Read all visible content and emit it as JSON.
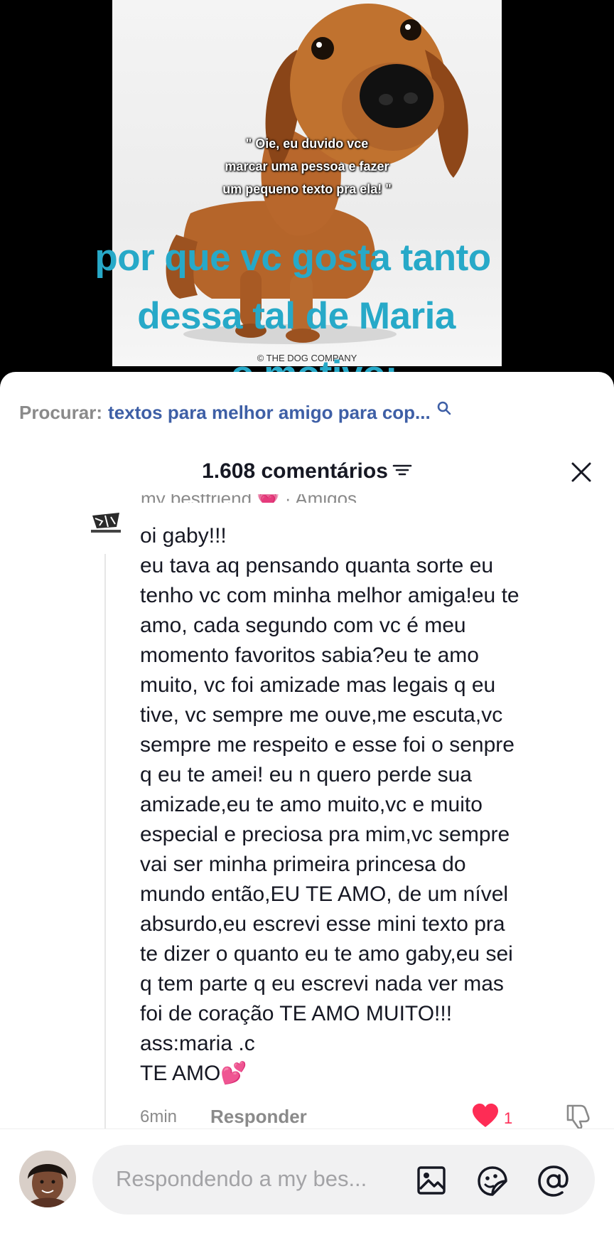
{
  "video": {
    "quote_lines": [
      "\" Oie, eu duvido vce",
      "marcar uma pessoa e fazer",
      "um pequeno texto pra ela! \""
    ],
    "watermark": "© THE DOG COMPANY",
    "caption_lines": [
      "por que vc gosta tanto",
      "dessa tal de Maria",
      "o motivo:"
    ]
  },
  "search": {
    "label": "Procurar:",
    "query": "textos para melhor amigo para cop...",
    "icon": "search-icon"
  },
  "header": {
    "count": "1.608 comentários",
    "filter_icon": "filter-icon",
    "close_icon": "close-icon"
  },
  "comment": {
    "author": "my bestfriend 💗 · Amigos",
    "text": "oi gaby!!!\neu tava aq pensando quanta sorte eu\ntenho vc com minha melhor amiga!eu te\namo, cada segundo com vc é meu\nmomento favoritos sabia?eu te amo\nmuito, vc foi amizade mas legais q eu\ntive, vc sempre me ouve,me escuta,vc\nsempre me respeito e esse foi o senpre\nq eu te amei! eu n quero perde sua\namizade,eu te amo muito,vc e muito\nespecial e preciosa pra mim,vc sempre\nvai ser minha primeira princesa do\nmundo então,EU TE AMO, de um nível\nabsurdo,eu escrevi esse mini texto pra\nte dizer o quanto eu te amo gaby,eu sei\nq tem parte q eu escrevi nada ver mas\nfoi de coração TE AMO MUITO!!!\nass:maria .c\nTE AMO💕",
    "time": "6min",
    "reply_label": "Responder",
    "like_count": "1",
    "colors": {
      "like": "#fe2c55",
      "link": "#3e5fa6",
      "caption": "#27a9c8"
    }
  },
  "composer": {
    "placeholder": "Respondendo a my bes...",
    "tools": [
      "image-icon",
      "emoji-sticker-icon",
      "mention-icon"
    ]
  }
}
